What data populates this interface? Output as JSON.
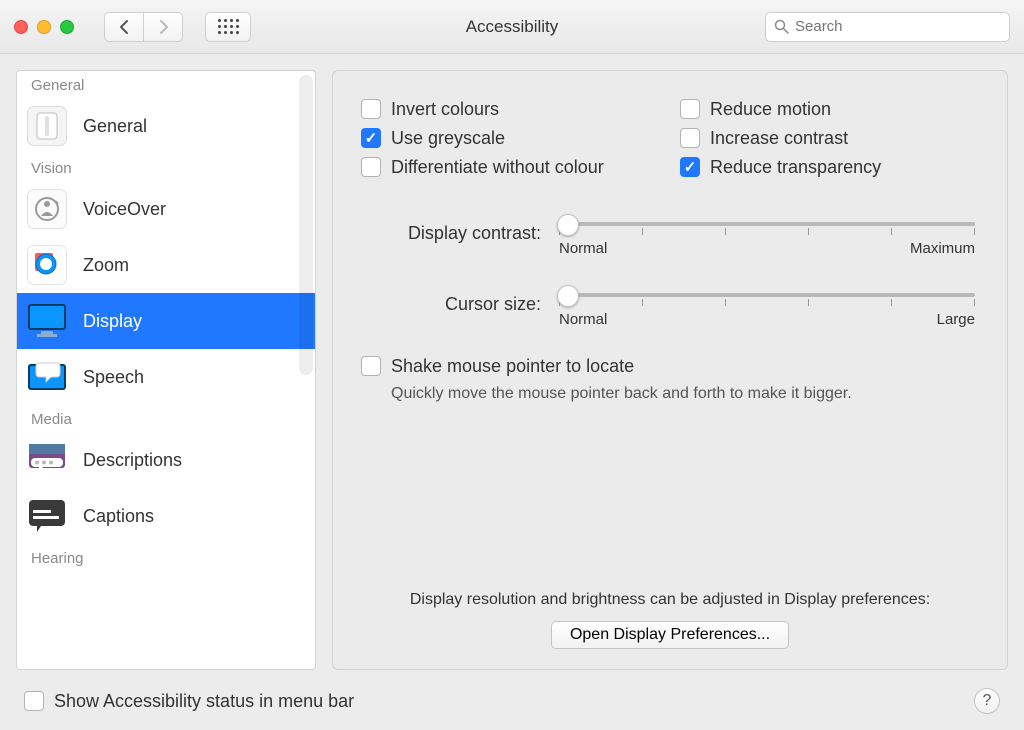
{
  "window": {
    "title": "Accessibility",
    "search_placeholder": "Search"
  },
  "sidebar": {
    "sections": [
      {
        "label": "General",
        "items": [
          {
            "label": "General",
            "icon": "general-icon"
          }
        ]
      },
      {
        "label": "Vision",
        "items": [
          {
            "label": "VoiceOver",
            "icon": "voiceover-icon"
          },
          {
            "label": "Zoom",
            "icon": "zoom-icon"
          },
          {
            "label": "Display",
            "icon": "display-icon",
            "selected": true
          },
          {
            "label": "Speech",
            "icon": "speech-icon"
          }
        ]
      },
      {
        "label": "Media",
        "items": [
          {
            "label": "Descriptions",
            "icon": "descriptions-icon"
          },
          {
            "label": "Captions",
            "icon": "captions-icon"
          }
        ]
      },
      {
        "label": "Hearing",
        "items": []
      }
    ]
  },
  "panel": {
    "checkboxes_left": [
      {
        "label": "Invert colours",
        "checked": false
      },
      {
        "label": "Use greyscale",
        "checked": true
      },
      {
        "label": "Differentiate without colour",
        "checked": false
      }
    ],
    "checkboxes_right": [
      {
        "label": "Reduce motion",
        "checked": false
      },
      {
        "label": "Increase contrast",
        "checked": false
      },
      {
        "label": "Reduce transparency",
        "checked": true
      }
    ],
    "contrast": {
      "label": "Display contrast:",
      "min_label": "Normal",
      "max_label": "Maximum",
      "value_pct": 3
    },
    "cursor": {
      "label": "Cursor size:",
      "min_label": "Normal",
      "max_label": "Large",
      "value_pct": 3
    },
    "shake": {
      "label": "Shake mouse pointer to locate",
      "checked": false,
      "note": "Quickly move the mouse pointer back and forth to make it bigger."
    },
    "footer_note": "Display resolution and brightness can be adjusted in Display preferences:",
    "open_button": "Open Display Preferences..."
  },
  "bottom": {
    "show_status": {
      "label": "Show Accessibility status in menu bar",
      "checked": false
    },
    "help": "?"
  }
}
